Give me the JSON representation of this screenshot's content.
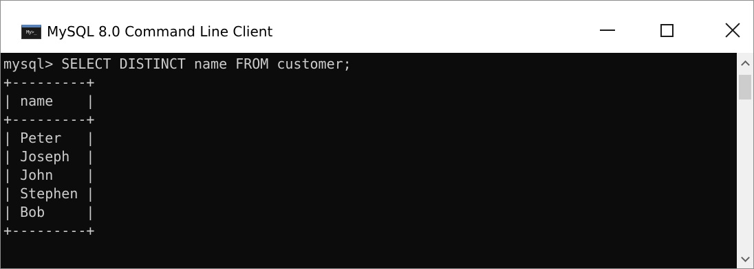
{
  "window": {
    "title": "MySQL 8.0 Command Line Client",
    "icon": "console-app-icon",
    "icon_text": "My>_"
  },
  "controls": {
    "minimize": "minimize-icon",
    "maximize": "maximize-icon",
    "close": "close-icon"
  },
  "console": {
    "background": "#0c0c0c",
    "foreground": "#cccccc",
    "lines": [
      "mysql> SELECT DISTINCT name FROM customer;",
      "+---------+",
      "| name    |",
      "+---------+",
      "| Peter   |",
      "| Joseph  |",
      "| John    |",
      "| Stephen |",
      "| Bob     |",
      "+---------+"
    ]
  },
  "scrollbar": {
    "up": "chevron-up-icon",
    "down": "chevron-down-icon"
  }
}
